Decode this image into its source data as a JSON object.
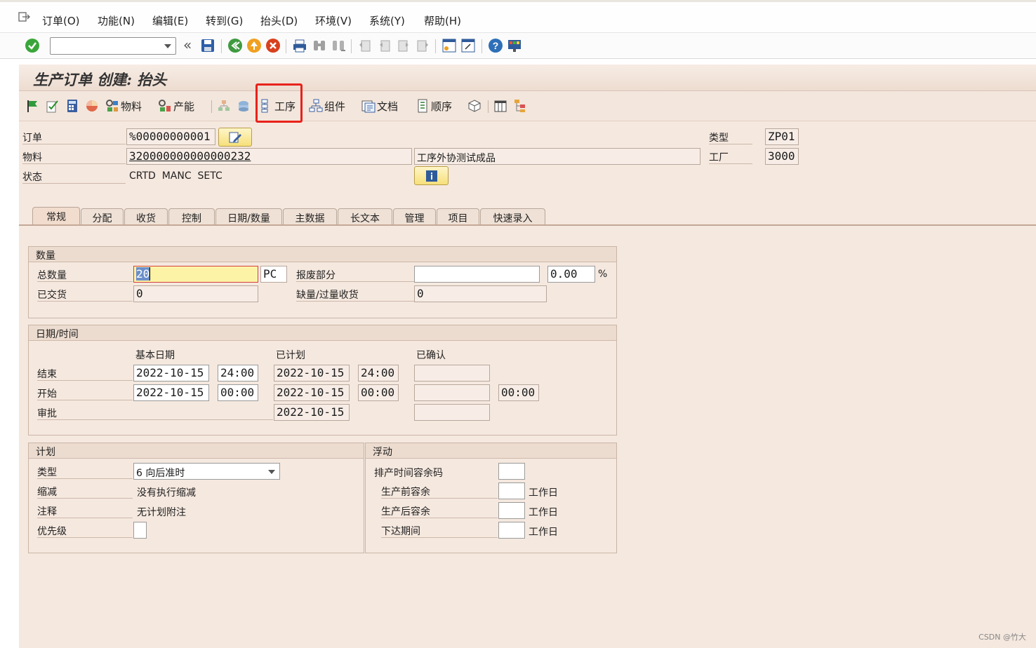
{
  "menu": {
    "items": [
      {
        "label": "订单(O)"
      },
      {
        "label": "功能(N)"
      },
      {
        "label": "编辑(E)"
      },
      {
        "label": "转到(G)"
      },
      {
        "label": "抬头(D)"
      },
      {
        "label": "环境(V)"
      },
      {
        "label": "系统(Y)"
      },
      {
        "label": "帮助(H)"
      }
    ]
  },
  "toolbar": {
    "command_field_value": "",
    "icons": [
      "enter-check-icon",
      "save-icon",
      "back-icon",
      "exit-icon",
      "cancel-icon",
      "print-icon",
      "find-icon",
      "find-next-icon",
      "first-page-icon",
      "previous-page-icon",
      "next-page-icon",
      "last-page-icon",
      "new-session-icon",
      "shortcut-icon",
      "help-icon",
      "customize-layout-icon"
    ]
  },
  "header": {
    "title": "生产订单 创建: 抬头"
  },
  "app_toolbar": {
    "material_label": "物料",
    "capacity_label": "产能",
    "operations_label": "工序",
    "components_label": "组件",
    "documents_label": "文档",
    "sequence_label": "顺序"
  },
  "order": {
    "order_label": "订单",
    "order_value": "%00000000001",
    "material_label": "物料",
    "material_value": "320000000000000232",
    "material_desc": "工序外协测试成品",
    "status_label": "状态",
    "status_value": "CRTD  MANC  SETC",
    "type_label": "类型",
    "type_value": "ZP01",
    "plant_label": "工厂",
    "plant_value": "3000"
  },
  "tabs": [
    {
      "label": "常规",
      "active": true
    },
    {
      "label": "分配"
    },
    {
      "label": "收货"
    },
    {
      "label": "控制"
    },
    {
      "label": "日期/数量"
    },
    {
      "label": "主数据"
    },
    {
      "label": "长文本"
    },
    {
      "label": "管理"
    },
    {
      "label": "项目"
    },
    {
      "label": "快速录入"
    }
  ],
  "quantity": {
    "group_title": "数量",
    "total_qty_label": "总数量",
    "total_qty_value": "20",
    "unit": "PC",
    "scrap_label": "报废部分",
    "scrap_value": "",
    "scrap_pct": "0.00",
    "pct_sign": "%",
    "delivered_label": "已交货",
    "delivered_value": "0",
    "short_over_label": "缺量/过量收货",
    "short_over_value": "0"
  },
  "dates": {
    "group_title": "日期/时间",
    "col_basic": "基本日期",
    "col_scheduled": "已计划",
    "col_confirmed": "已确认",
    "finish_label": "结束",
    "finish_basic_date": "2022-10-15",
    "finish_basic_time": "24:00",
    "finish_sched_date": "2022-10-15",
    "finish_sched_time": "24:00",
    "finish_conf_date": "",
    "start_label": "开始",
    "start_basic_date": "2022-10-15",
    "start_basic_time": "00:00",
    "start_sched_date": "2022-10-15",
    "start_sched_time": "00:00",
    "start_conf_date": "",
    "start_conf_time": "00:00",
    "release_label": "审批",
    "release_sched_date": "2022-10-15",
    "release_conf_date": ""
  },
  "scheduling": {
    "group_title": "计划",
    "type_label": "类型",
    "type_value": "6 向后准时",
    "reduction_label": "缩减",
    "reduction_value": "没有执行缩减",
    "note_label": "注释",
    "note_value": "无计划附注",
    "priority_label": "优先级",
    "priority_value": ""
  },
  "float": {
    "group_title": "浮动",
    "sched_margin_label": "排产时间容余码",
    "sched_margin_value": "",
    "float_before_label": "生产前容余",
    "float_before_value": "",
    "float_after_label": "生产后容余",
    "float_after_value": "",
    "release_period_label": "下达期间",
    "release_period_value": "",
    "workday_unit": "工作日"
  },
  "watermark": "CSDN @竹大"
}
